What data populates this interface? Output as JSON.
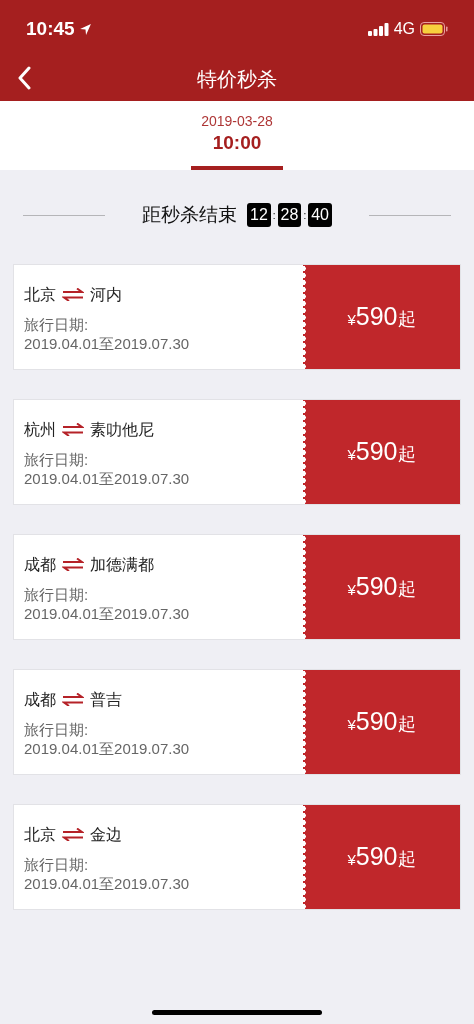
{
  "status_bar": {
    "time": "10:45",
    "network": "4G"
  },
  "nav_bar": {
    "title": "特价秒杀"
  },
  "date_tabs": [
    {
      "date": "2019-03-28",
      "time": "10:00",
      "selected": true
    }
  ],
  "countdown": {
    "label": "距秒杀结束",
    "hours": "12",
    "separator_1": ":",
    "minutes": "28",
    "separator_2": ":",
    "seconds": "40"
  },
  "deals": [
    {
      "from": "北京",
      "to": "河内",
      "date_label": "旅行日期:",
      "date_range": "2019.04.01至2019.07.30",
      "currency": "¥",
      "amount": "590",
      "suffix": "起"
    },
    {
      "from": "杭州",
      "to": "素叻他尼",
      "date_label": "旅行日期:",
      "date_range": "2019.04.01至2019.07.30",
      "currency": "¥",
      "amount": "590",
      "suffix": "起"
    },
    {
      "from": "成都",
      "to": "加德满都",
      "date_label": "旅行日期:",
      "date_range": "2019.04.01至2019.07.30",
      "currency": "¥",
      "amount": "590",
      "suffix": "起"
    },
    {
      "from": "成都",
      "to": "普吉",
      "date_label": "旅行日期:",
      "date_range": "2019.04.01至2019.07.30",
      "currency": "¥",
      "amount": "590",
      "suffix": "起"
    },
    {
      "from": "北京",
      "to": "金边",
      "date_label": "旅行日期:",
      "date_range": "2019.04.01至2019.07.30",
      "currency": "¥",
      "amount": "590",
      "suffix": "起"
    }
  ]
}
